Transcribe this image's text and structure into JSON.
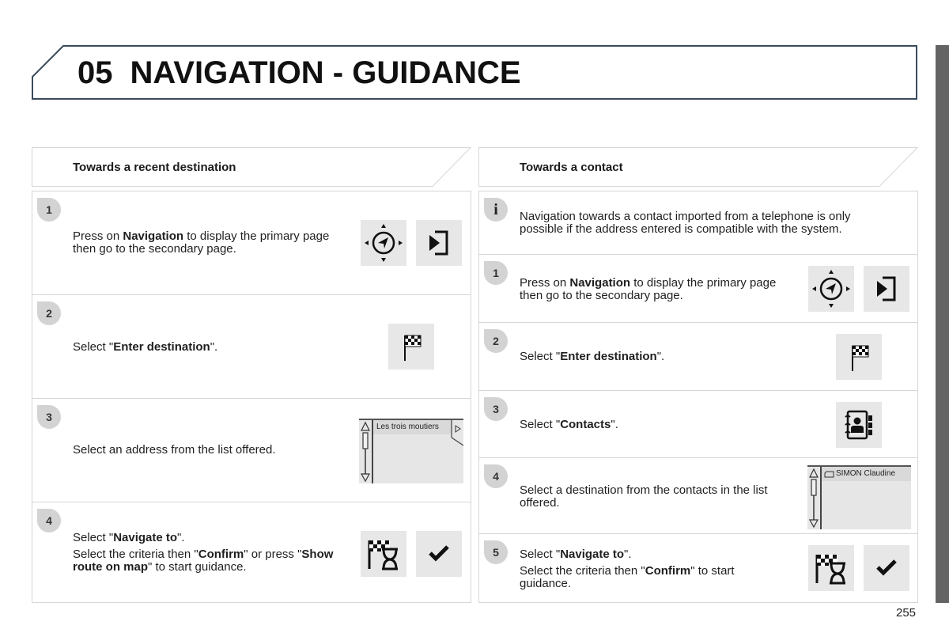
{
  "page": {
    "chapter_number": "05",
    "chapter_title": "NAVIGATION - GUIDANCE",
    "page_number": "255"
  },
  "left_section": {
    "title": "Towards a recent destination",
    "steps": [
      {
        "badge": "1",
        "text_parts": [
          "Press on ",
          "Navigation",
          " to display the primary page then go to the secondary page."
        ],
        "icons": [
          "navigation-compass-icon",
          "secondary-page-icon"
        ]
      },
      {
        "badge": "2",
        "text_parts": [
          "Select \"",
          "Enter destination",
          "\"."
        ],
        "icons": [
          "checkered-flag-icon"
        ]
      },
      {
        "badge": "3",
        "text": "Select an address from the list offered.",
        "list_item": "Les trois moutiers"
      },
      {
        "badge": "4",
        "line1_parts": [
          "Select \"",
          "Navigate to",
          "\"."
        ],
        "line2_parts": [
          "Select the criteria then \"",
          "Confirm",
          "\" or press \"",
          "Show route on map",
          "\" to start guidance."
        ],
        "icons": [
          "route-criteria-icon",
          "confirm-check-icon"
        ]
      }
    ]
  },
  "right_section": {
    "title": "Towards a contact",
    "info": {
      "badge": "i",
      "text": "Navigation towards a contact imported from a telephone is only possible if the address entered is compatible with the system."
    },
    "steps": [
      {
        "badge": "1",
        "text_parts": [
          "Press on ",
          "Navigation",
          " to display the primary page then go to the secondary page."
        ],
        "icons": [
          "navigation-compass-icon",
          "secondary-page-icon"
        ]
      },
      {
        "badge": "2",
        "text_parts": [
          "Select \"",
          "Enter destination",
          "\"."
        ],
        "icons": [
          "checkered-flag-icon"
        ]
      },
      {
        "badge": "3",
        "text_parts": [
          "Select \"",
          "Contacts",
          "\"."
        ],
        "icons": [
          "contacts-book-icon"
        ]
      },
      {
        "badge": "4",
        "text": "Select a destination from the contacts in the list offered.",
        "list_item": "SIMON Claudine"
      },
      {
        "badge": "5",
        "line1_parts": [
          "Select \"",
          "Navigate to",
          "\"."
        ],
        "line2_parts": [
          "Select the criteria then \"",
          "Confirm",
          "\" to start guidance."
        ],
        "icons": [
          "route-criteria-icon",
          "confirm-check-icon"
        ]
      }
    ]
  },
  "colors": {
    "side_tab": "#646464",
    "badge": "#d3d3d3",
    "icon_bg": "#e7e7e7",
    "banner_border": "#3a4a5a"
  }
}
